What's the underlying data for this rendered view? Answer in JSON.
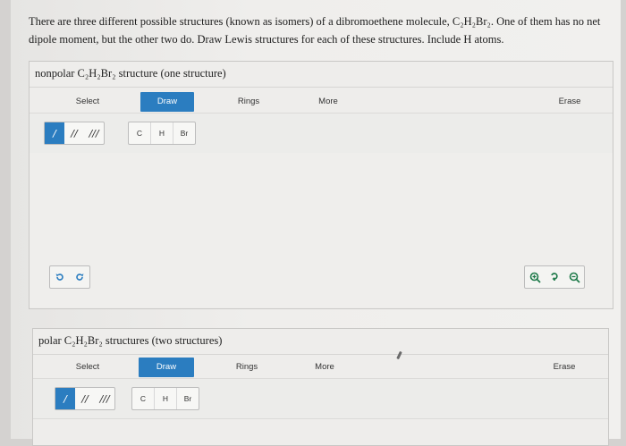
{
  "question": "There are three different possible structures (known as isomers) of a dibromoethene molecule, C₂H₂Br₂. One of them has no net dipole moment, but the other two do. Draw Lewis structures for each of these structures. Include H atoms.",
  "panel_nonpolar": {
    "title": "nonpolar C₂H₂Br₂ structure (one structure)",
    "toolbar": {
      "select": "Select",
      "draw": "Draw",
      "rings": "Rings",
      "more": "More",
      "erase": "Erase"
    },
    "bonds": [
      "/",
      "//",
      "///"
    ],
    "atoms": [
      "C",
      "H",
      "Br"
    ],
    "undo_icon": "undo-icon",
    "redo_icon": "redo-icon",
    "zoom_in_icon": "zoom-in-icon",
    "reset_icon": "reset-zoom-icon",
    "zoom_out_icon": "zoom-out-icon"
  },
  "panel_polar": {
    "title": "polar C₂H₂Br₂ structures (two structures)",
    "toolbar": {
      "select": "Select",
      "draw": "Draw",
      "rings": "Rings",
      "more": "More",
      "erase": "Erase"
    },
    "bonds": [
      "/",
      "//",
      "///"
    ],
    "atoms": [
      "C",
      "H",
      "Br"
    ]
  },
  "colors": {
    "accent": "#2b7dc0",
    "zoom": "#1f7a4a"
  }
}
